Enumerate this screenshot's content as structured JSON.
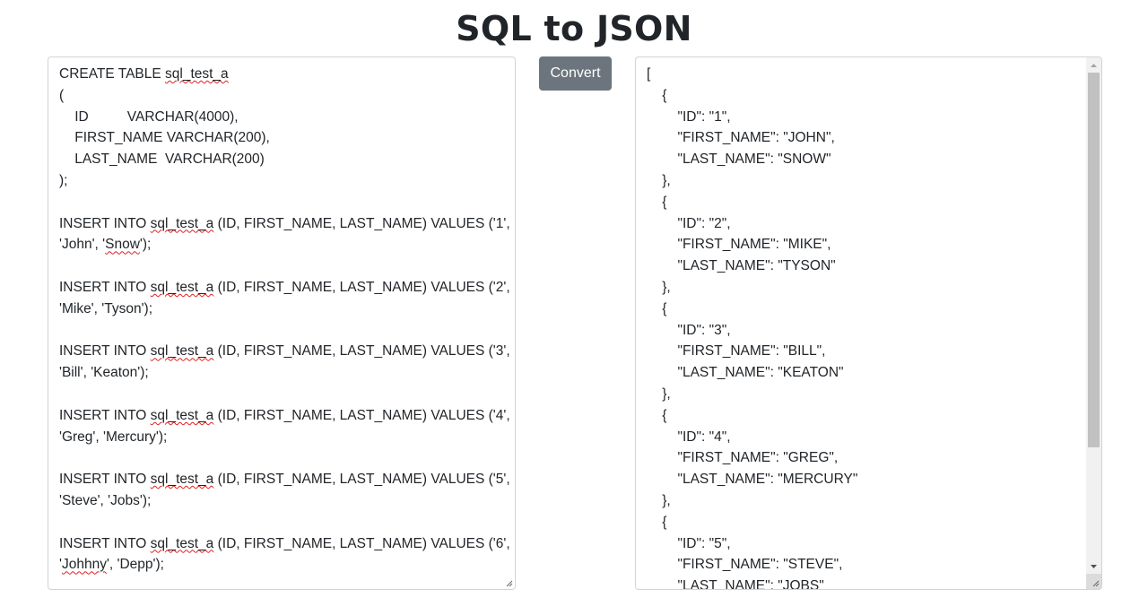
{
  "page": {
    "title": "SQL to JSON"
  },
  "sql_input": {
    "lines": [
      {
        "parts": [
          {
            "t": "CREATE TABLE "
          },
          {
            "t": "sql_test_a",
            "spell": true
          }
        ]
      },
      {
        "parts": [
          {
            "t": "("
          }
        ]
      },
      {
        "parts": [
          {
            "t": "    ID          VARCHAR(4000),"
          }
        ]
      },
      {
        "parts": [
          {
            "t": "    FIRST_NAME VARCHAR(200),"
          }
        ]
      },
      {
        "parts": [
          {
            "t": "    LAST_NAME  VARCHAR(200)"
          }
        ]
      },
      {
        "parts": [
          {
            "t": ");"
          }
        ]
      },
      {
        "parts": [
          {
            "t": ""
          }
        ]
      },
      {
        "parts": [
          {
            "t": "INSERT INTO "
          },
          {
            "t": "sql_test_a",
            "spell": true
          },
          {
            "t": " (ID, FIRST_NAME, LAST_NAME) VALUES ('1',"
          }
        ]
      },
      {
        "parts": [
          {
            "t": "'John', '"
          },
          {
            "t": "Snow",
            "spell": true
          },
          {
            "t": "');"
          }
        ]
      },
      {
        "parts": [
          {
            "t": ""
          }
        ]
      },
      {
        "parts": [
          {
            "t": "INSERT INTO "
          },
          {
            "t": "sql_test_a",
            "spell": true
          },
          {
            "t": " (ID, FIRST_NAME, LAST_NAME) VALUES ('2',"
          }
        ]
      },
      {
        "parts": [
          {
            "t": "'Mike', 'Tyson');"
          }
        ]
      },
      {
        "parts": [
          {
            "t": ""
          }
        ]
      },
      {
        "parts": [
          {
            "t": "INSERT INTO "
          },
          {
            "t": "sql_test_a",
            "spell": true
          },
          {
            "t": " (ID, FIRST_NAME, LAST_NAME) VALUES ('3',"
          }
        ]
      },
      {
        "parts": [
          {
            "t": "'Bill', 'Keaton');"
          }
        ]
      },
      {
        "parts": [
          {
            "t": ""
          }
        ]
      },
      {
        "parts": [
          {
            "t": "INSERT INTO "
          },
          {
            "t": "sql_test_a",
            "spell": true
          },
          {
            "t": " (ID, FIRST_NAME, LAST_NAME) VALUES ('4',"
          }
        ]
      },
      {
        "parts": [
          {
            "t": "'Greg', 'Mercury');"
          }
        ]
      },
      {
        "parts": [
          {
            "t": ""
          }
        ]
      },
      {
        "parts": [
          {
            "t": "INSERT INTO "
          },
          {
            "t": "sql_test_a",
            "spell": true
          },
          {
            "t": " (ID, FIRST_NAME, LAST_NAME) VALUES ('5',"
          }
        ]
      },
      {
        "parts": [
          {
            "t": "'Steve', 'Jobs');"
          }
        ]
      },
      {
        "parts": [
          {
            "t": ""
          }
        ]
      },
      {
        "parts": [
          {
            "t": "INSERT INTO "
          },
          {
            "t": "sql_test_a",
            "spell": true
          },
          {
            "t": " (ID, FIRST_NAME, LAST_NAME) VALUES ('6',"
          }
        ]
      },
      {
        "parts": [
          {
            "t": "'"
          },
          {
            "t": "Johhny",
            "spell": true
          },
          {
            "t": "', 'Depp');"
          }
        ]
      }
    ]
  },
  "convert_button": {
    "label": "Convert"
  },
  "json_output": {
    "lines": [
      "[",
      "    {",
      "        \"ID\": \"1\",",
      "        \"FIRST_NAME\": \"JOHN\",",
      "        \"LAST_NAME\": \"SNOW\"",
      "    },",
      "    {",
      "        \"ID\": \"2\",",
      "        \"FIRST_NAME\": \"MIKE\",",
      "        \"LAST_NAME\": \"TYSON\"",
      "    },",
      "    {",
      "        \"ID\": \"3\",",
      "        \"FIRST_NAME\": \"BILL\",",
      "        \"LAST_NAME\": \"KEATON\"",
      "    },",
      "    {",
      "        \"ID\": \"4\",",
      "        \"FIRST_NAME\": \"GREG\",",
      "        \"LAST_NAME\": \"MERCURY\"",
      "    },",
      "    {",
      "        \"ID\": \"5\",",
      "        \"FIRST_NAME\": \"STEVE\",",
      "        \"LAST_NAME\": \"JOBS\""
    ],
    "scroll_position": 0
  }
}
